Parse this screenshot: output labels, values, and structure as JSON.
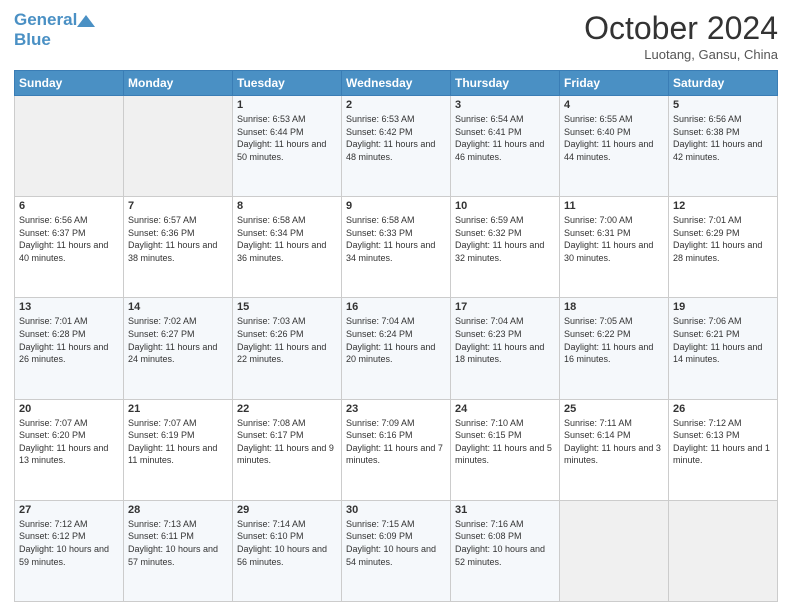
{
  "header": {
    "logo_line1": "General",
    "logo_line2": "Blue",
    "month": "October 2024",
    "location": "Luotang, Gansu, China"
  },
  "weekdays": [
    "Sunday",
    "Monday",
    "Tuesday",
    "Wednesday",
    "Thursday",
    "Friday",
    "Saturday"
  ],
  "weeks": [
    [
      {
        "day": "",
        "sunrise": "",
        "sunset": "",
        "daylight": ""
      },
      {
        "day": "",
        "sunrise": "",
        "sunset": "",
        "daylight": ""
      },
      {
        "day": "1",
        "sunrise": "Sunrise: 6:53 AM",
        "sunset": "Sunset: 6:44 PM",
        "daylight": "Daylight: 11 hours and 50 minutes."
      },
      {
        "day": "2",
        "sunrise": "Sunrise: 6:53 AM",
        "sunset": "Sunset: 6:42 PM",
        "daylight": "Daylight: 11 hours and 48 minutes."
      },
      {
        "day": "3",
        "sunrise": "Sunrise: 6:54 AM",
        "sunset": "Sunset: 6:41 PM",
        "daylight": "Daylight: 11 hours and 46 minutes."
      },
      {
        "day": "4",
        "sunrise": "Sunrise: 6:55 AM",
        "sunset": "Sunset: 6:40 PM",
        "daylight": "Daylight: 11 hours and 44 minutes."
      },
      {
        "day": "5",
        "sunrise": "Sunrise: 6:56 AM",
        "sunset": "Sunset: 6:38 PM",
        "daylight": "Daylight: 11 hours and 42 minutes."
      }
    ],
    [
      {
        "day": "6",
        "sunrise": "Sunrise: 6:56 AM",
        "sunset": "Sunset: 6:37 PM",
        "daylight": "Daylight: 11 hours and 40 minutes."
      },
      {
        "day": "7",
        "sunrise": "Sunrise: 6:57 AM",
        "sunset": "Sunset: 6:36 PM",
        "daylight": "Daylight: 11 hours and 38 minutes."
      },
      {
        "day": "8",
        "sunrise": "Sunrise: 6:58 AM",
        "sunset": "Sunset: 6:34 PM",
        "daylight": "Daylight: 11 hours and 36 minutes."
      },
      {
        "day": "9",
        "sunrise": "Sunrise: 6:58 AM",
        "sunset": "Sunset: 6:33 PM",
        "daylight": "Daylight: 11 hours and 34 minutes."
      },
      {
        "day": "10",
        "sunrise": "Sunrise: 6:59 AM",
        "sunset": "Sunset: 6:32 PM",
        "daylight": "Daylight: 11 hours and 32 minutes."
      },
      {
        "day": "11",
        "sunrise": "Sunrise: 7:00 AM",
        "sunset": "Sunset: 6:31 PM",
        "daylight": "Daylight: 11 hours and 30 minutes."
      },
      {
        "day": "12",
        "sunrise": "Sunrise: 7:01 AM",
        "sunset": "Sunset: 6:29 PM",
        "daylight": "Daylight: 11 hours and 28 minutes."
      }
    ],
    [
      {
        "day": "13",
        "sunrise": "Sunrise: 7:01 AM",
        "sunset": "Sunset: 6:28 PM",
        "daylight": "Daylight: 11 hours and 26 minutes."
      },
      {
        "day": "14",
        "sunrise": "Sunrise: 7:02 AM",
        "sunset": "Sunset: 6:27 PM",
        "daylight": "Daylight: 11 hours and 24 minutes."
      },
      {
        "day": "15",
        "sunrise": "Sunrise: 7:03 AM",
        "sunset": "Sunset: 6:26 PM",
        "daylight": "Daylight: 11 hours and 22 minutes."
      },
      {
        "day": "16",
        "sunrise": "Sunrise: 7:04 AM",
        "sunset": "Sunset: 6:24 PM",
        "daylight": "Daylight: 11 hours and 20 minutes."
      },
      {
        "day": "17",
        "sunrise": "Sunrise: 7:04 AM",
        "sunset": "Sunset: 6:23 PM",
        "daylight": "Daylight: 11 hours and 18 minutes."
      },
      {
        "day": "18",
        "sunrise": "Sunrise: 7:05 AM",
        "sunset": "Sunset: 6:22 PM",
        "daylight": "Daylight: 11 hours and 16 minutes."
      },
      {
        "day": "19",
        "sunrise": "Sunrise: 7:06 AM",
        "sunset": "Sunset: 6:21 PM",
        "daylight": "Daylight: 11 hours and 14 minutes."
      }
    ],
    [
      {
        "day": "20",
        "sunrise": "Sunrise: 7:07 AM",
        "sunset": "Sunset: 6:20 PM",
        "daylight": "Daylight: 11 hours and 13 minutes."
      },
      {
        "day": "21",
        "sunrise": "Sunrise: 7:07 AM",
        "sunset": "Sunset: 6:19 PM",
        "daylight": "Daylight: 11 hours and 11 minutes."
      },
      {
        "day": "22",
        "sunrise": "Sunrise: 7:08 AM",
        "sunset": "Sunset: 6:17 PM",
        "daylight": "Daylight: 11 hours and 9 minutes."
      },
      {
        "day": "23",
        "sunrise": "Sunrise: 7:09 AM",
        "sunset": "Sunset: 6:16 PM",
        "daylight": "Daylight: 11 hours and 7 minutes."
      },
      {
        "day": "24",
        "sunrise": "Sunrise: 7:10 AM",
        "sunset": "Sunset: 6:15 PM",
        "daylight": "Daylight: 11 hours and 5 minutes."
      },
      {
        "day": "25",
        "sunrise": "Sunrise: 7:11 AM",
        "sunset": "Sunset: 6:14 PM",
        "daylight": "Daylight: 11 hours and 3 minutes."
      },
      {
        "day": "26",
        "sunrise": "Sunrise: 7:12 AM",
        "sunset": "Sunset: 6:13 PM",
        "daylight": "Daylight: 11 hours and 1 minute."
      }
    ],
    [
      {
        "day": "27",
        "sunrise": "Sunrise: 7:12 AM",
        "sunset": "Sunset: 6:12 PM",
        "daylight": "Daylight: 10 hours and 59 minutes."
      },
      {
        "day": "28",
        "sunrise": "Sunrise: 7:13 AM",
        "sunset": "Sunset: 6:11 PM",
        "daylight": "Daylight: 10 hours and 57 minutes."
      },
      {
        "day": "29",
        "sunrise": "Sunrise: 7:14 AM",
        "sunset": "Sunset: 6:10 PM",
        "daylight": "Daylight: 10 hours and 56 minutes."
      },
      {
        "day": "30",
        "sunrise": "Sunrise: 7:15 AM",
        "sunset": "Sunset: 6:09 PM",
        "daylight": "Daylight: 10 hours and 54 minutes."
      },
      {
        "day": "31",
        "sunrise": "Sunrise: 7:16 AM",
        "sunset": "Sunset: 6:08 PM",
        "daylight": "Daylight: 10 hours and 52 minutes."
      },
      {
        "day": "",
        "sunrise": "",
        "sunset": "",
        "daylight": ""
      },
      {
        "day": "",
        "sunrise": "",
        "sunset": "",
        "daylight": ""
      }
    ]
  ]
}
